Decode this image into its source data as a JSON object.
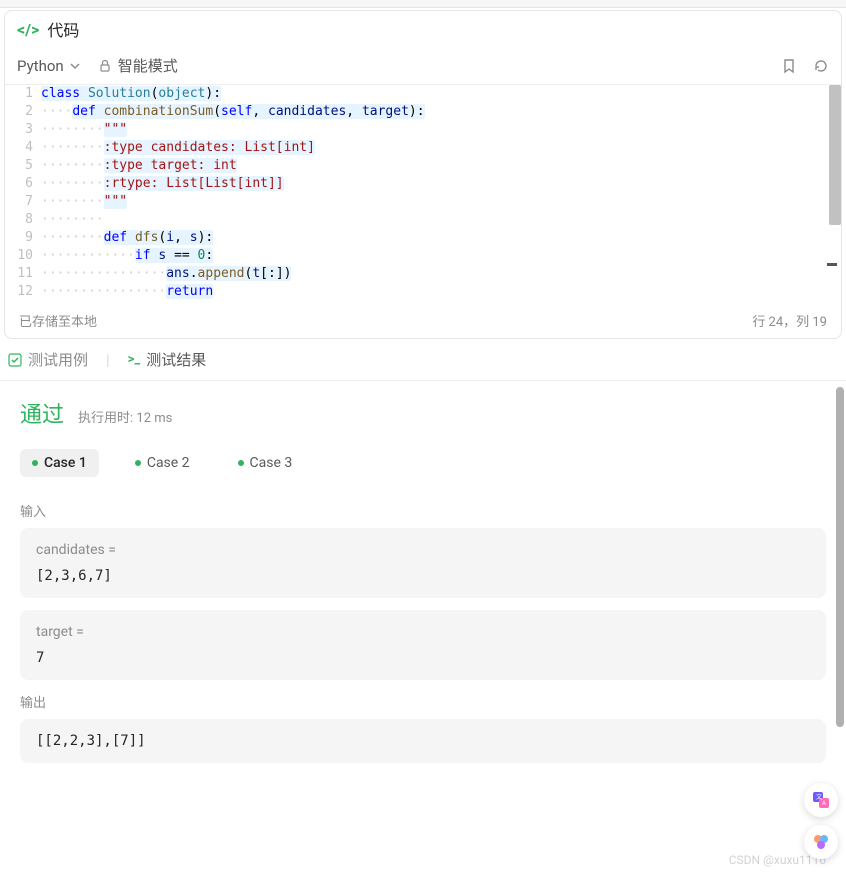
{
  "header": {
    "title": "代码"
  },
  "toolbar": {
    "language": "Python",
    "mode_label": "智能模式",
    "icons": {
      "bookmark": "bookmark-icon",
      "reset": "reset-icon",
      "lock": "lock-icon"
    }
  },
  "editor": {
    "lines": [
      {
        "n": 1,
        "indent": 0,
        "hl": true,
        "tokens": [
          [
            "kw",
            "class"
          ],
          [
            "sp",
            " "
          ],
          [
            "cls",
            "Solution"
          ],
          [
            "op",
            "("
          ],
          [
            "cls",
            "object"
          ],
          [
            "op",
            "):"
          ]
        ]
      },
      {
        "n": 2,
        "indent": 1,
        "hl": true,
        "tokens": [
          [
            "kw",
            "def"
          ],
          [
            "sp",
            " "
          ],
          [
            "fn",
            "combinationSum"
          ],
          [
            "op",
            "("
          ],
          [
            "self",
            "self"
          ],
          [
            "op",
            ", "
          ],
          [
            "param",
            "candidates"
          ],
          [
            "op",
            ", "
          ],
          [
            "param",
            "target"
          ],
          [
            "op",
            "):"
          ]
        ]
      },
      {
        "n": 3,
        "indent": 2,
        "hl": true,
        "tokens": [
          [
            "str",
            "\"\"\""
          ]
        ]
      },
      {
        "n": 4,
        "indent": 2,
        "hl": true,
        "tokens": [
          [
            "str",
            ":type candidates: List[int]"
          ]
        ]
      },
      {
        "n": 5,
        "indent": 2,
        "hl": true,
        "tokens": [
          [
            "str",
            ":type target: int"
          ]
        ]
      },
      {
        "n": 6,
        "indent": 2,
        "hl": true,
        "tokens": [
          [
            "str",
            ":rtype: List[List[int]]"
          ]
        ]
      },
      {
        "n": 7,
        "indent": 2,
        "hl": true,
        "tokens": [
          [
            "str",
            "\"\"\""
          ]
        ]
      },
      {
        "n": 8,
        "indent": 2,
        "hl": false,
        "tokens": []
      },
      {
        "n": 9,
        "indent": 2,
        "hl": true,
        "tokens": [
          [
            "kw",
            "def"
          ],
          [
            "sp",
            " "
          ],
          [
            "fn",
            "dfs"
          ],
          [
            "op",
            "("
          ],
          [
            "param",
            "i"
          ],
          [
            "op",
            ", "
          ],
          [
            "param",
            "s"
          ],
          [
            "op",
            "):"
          ]
        ]
      },
      {
        "n": 10,
        "indent": 3,
        "hl": true,
        "tokens": [
          [
            "kw",
            "if"
          ],
          [
            "sp",
            " "
          ],
          [
            "param",
            "s"
          ],
          [
            "sp",
            " "
          ],
          [
            "op",
            "=="
          ],
          [
            "sp",
            " "
          ],
          [
            "num",
            "0"
          ],
          [
            "op",
            ":"
          ]
        ]
      },
      {
        "n": 11,
        "indent": 4,
        "hl": true,
        "tokens": [
          [
            "param",
            "ans"
          ],
          [
            "op",
            "."
          ],
          [
            "fn",
            "append"
          ],
          [
            "op",
            "("
          ],
          [
            "param",
            "t"
          ],
          [
            "op",
            "[:])"
          ]
        ]
      },
      {
        "n": 12,
        "indent": 4,
        "hl": true,
        "tokens": [
          [
            "kw",
            "return"
          ]
        ]
      }
    ]
  },
  "status": {
    "saved_text": "已存储至本地",
    "cursor_text": "行 24，列 19"
  },
  "tabs": {
    "testcase_label": "测试用例",
    "result_label": "测试结果"
  },
  "result": {
    "status_text": "通过",
    "runtime_label": "执行用时:",
    "runtime_value": "12 ms",
    "cases": [
      "Case 1",
      "Case 2",
      "Case 3"
    ],
    "active_case": 0,
    "input_label": "输入",
    "output_label": "输出",
    "inputs": [
      {
        "name": "candidates =",
        "value": "[2,3,6,7]"
      },
      {
        "name": "target =",
        "value": "7"
      }
    ],
    "output_value": "[[2,2,3],[7]]"
  },
  "watermark": "CSDN @xuxu1116"
}
